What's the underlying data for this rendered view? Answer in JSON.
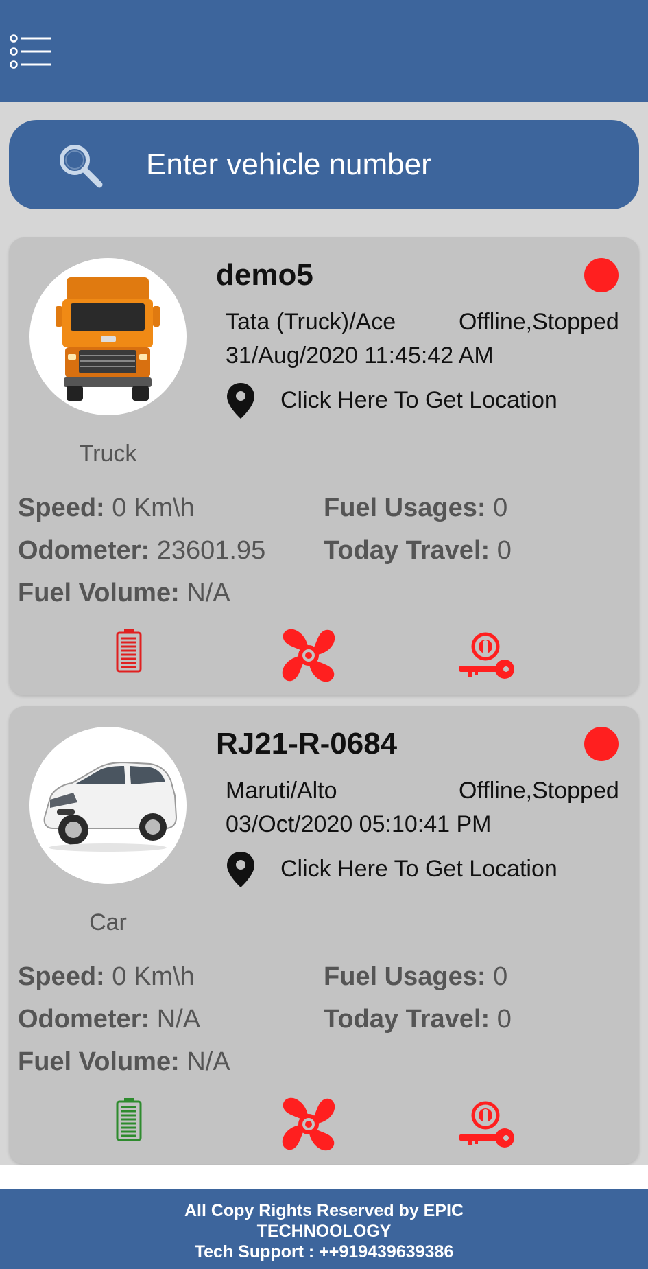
{
  "search": {
    "placeholder": "Enter vehicle number"
  },
  "vehicles": [
    {
      "name": "demo5",
      "type": "Truck",
      "model": "Tata (Truck)/Ace",
      "state": "Offline,Stopped",
      "datetime": "31/Aug/2020 11:45:42 AM",
      "location_link": "Click Here To Get Location",
      "stats": {
        "speed_label": "Speed:",
        "speed_value": "0 Km\\h",
        "fuel_usage_label": "Fuel Usages:",
        "fuel_usage_value": "0",
        "odometer_label": "Odometer:",
        "odometer_value": "23601.95",
        "today_travel_label": "Today Travel:",
        "today_travel_value": "0",
        "fuel_volume_label": "Fuel Volume:",
        "fuel_volume_value": "N/A"
      },
      "status_color": "#ff1f1f",
      "icons": {
        "battery": "battery-icon",
        "battery_color": "#e02020",
        "fan": "fan-icon",
        "fan_color": "#ff1f1f",
        "ignition": "ignition-key-icon",
        "ignition_color": "#ff1f1f"
      }
    },
    {
      "name": "RJ21-R-0684",
      "type": "Car",
      "model": "Maruti/Alto",
      "state": "Offline,Stopped",
      "datetime": "03/Oct/2020 05:10:41 PM",
      "location_link": "Click Here To Get Location",
      "stats": {
        "speed_label": "Speed:",
        "speed_value": "0 Km\\h",
        "fuel_usage_label": "Fuel Usages:",
        "fuel_usage_value": "0",
        "odometer_label": "Odometer:",
        "odometer_value": "N/A",
        "today_travel_label": "Today Travel:",
        "today_travel_value": "0",
        "fuel_volume_label": "Fuel Volume:",
        "fuel_volume_value": "N/A"
      },
      "status_color": "#ff1f1f",
      "icons": {
        "battery": "battery-icon",
        "battery_color": "#2e8b2e",
        "fan": "fan-icon",
        "fan_color": "#ff1f1f",
        "ignition": "ignition-key-icon",
        "ignition_color": "#ff1f1f"
      }
    }
  ],
  "footer": {
    "line1": "All Copy Rights Reserved by EPIC",
    "line2": "TECHNOOLOGY",
    "line3": "Tech Support : ++919439639386"
  },
  "colors": {
    "primary": "#3d659c",
    "card": "#c3c3c3",
    "background": "#d6d6d6"
  }
}
